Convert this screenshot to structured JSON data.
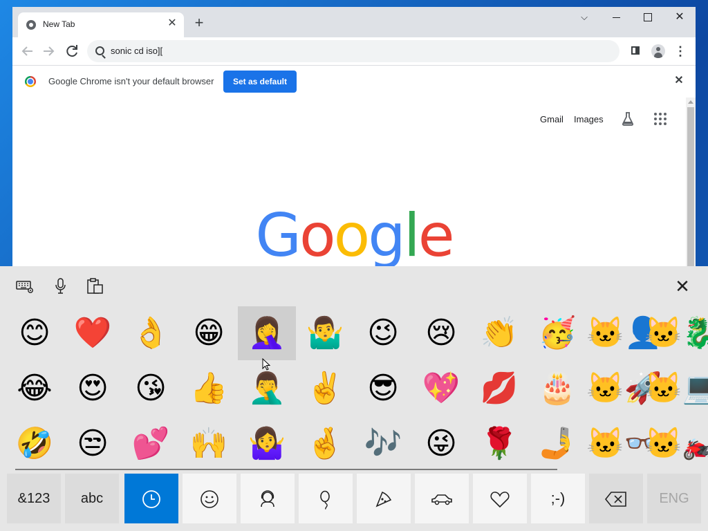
{
  "browser": {
    "tab": {
      "title": "New Tab",
      "close": "✕"
    },
    "new_tab": "+",
    "window_controls": {
      "dropdown": "⌵",
      "close": "✕"
    },
    "omnibox": {
      "text": "sonic cd iso]["
    },
    "menu": "⋮",
    "infobar": {
      "message": "Google Chrome isn't your default browser",
      "button": "Set as default",
      "close": "✕"
    },
    "page": {
      "gmail": "Gmail",
      "images": "Images",
      "logo_letters": [
        {
          "char": "G",
          "color": "#4285f4"
        },
        {
          "char": "o",
          "color": "#ea4335"
        },
        {
          "char": "o",
          "color": "#fbbc05"
        },
        {
          "char": "g",
          "color": "#4285f4"
        },
        {
          "char": "l",
          "color": "#34a853"
        },
        {
          "char": "e",
          "color": "#ea4335"
        }
      ]
    }
  },
  "keyboard": {
    "close": "✕",
    "emoji_rows": [
      [
        "😊",
        "❤️",
        "👌",
        "😁",
        "🤦‍♀️",
        "🤷‍♂️",
        "😉",
        "😢",
        "👏",
        "🥳",
        "🐱‍👤",
        "🐱‍🐉"
      ],
      [
        "😂",
        "😍",
        "😘",
        "👍",
        "🤦‍♂️",
        "✌️",
        "😎",
        "💖",
        "💋",
        "🎂",
        "🐱‍🚀",
        "🐱‍💻"
      ],
      [
        "🤣",
        "😒",
        "💕",
        "🙌",
        "🤷‍♀️",
        "🤞",
        "🎶",
        "😜",
        "🌹",
        "🤳",
        "🐱‍👓",
        "🐱‍🏍"
      ]
    ],
    "keys": {
      "symbols": "&123",
      "abc": "abc",
      "emoticon": ";-)",
      "language": "ENG"
    },
    "category_icons": [
      "clock-icon",
      "smiley-icon",
      "person-icon",
      "balloon-icon",
      "pizza-icon",
      "car-icon",
      "heart-icon"
    ],
    "accent_color": "#0078d7"
  }
}
